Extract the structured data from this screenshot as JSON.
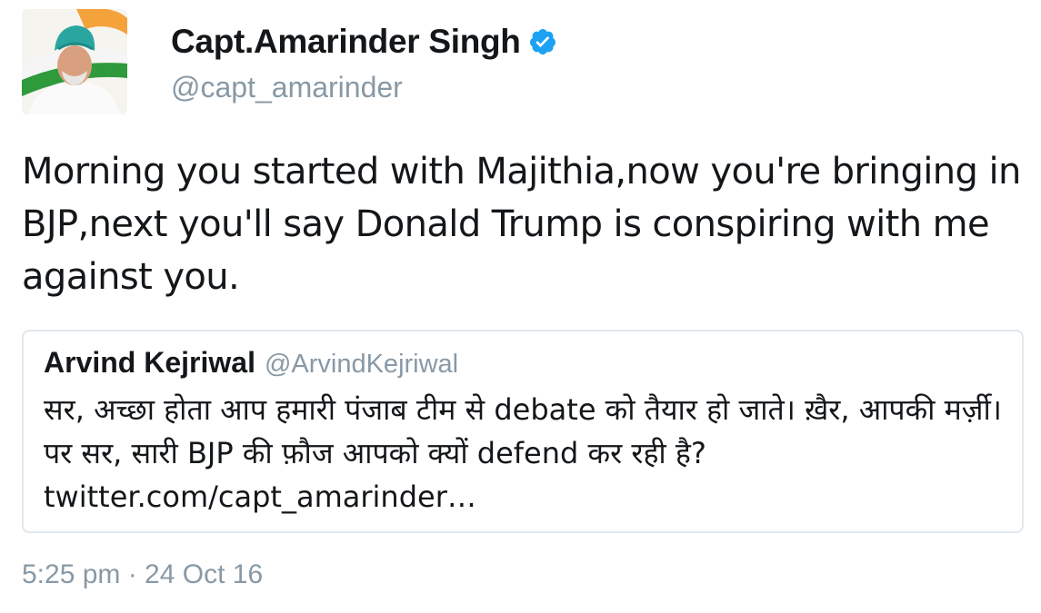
{
  "author": {
    "name": "Capt.Amarinder Singh",
    "handle": "@capt_amarinder",
    "verified": true,
    "avatar_icon": "profile-photo-turban-tricolor"
  },
  "tweet": {
    "text": "Morning you started with Majithia,now you're bringing in BJP,next you'll say Donald Trump is conspiring with me against you."
  },
  "quoted_tweet": {
    "name": "Arvind Kejriwal",
    "handle": "@ArvindKejriwal",
    "text": "सर, अच्छा होता आप हमारी पंजाब टीम से debate को तैयार हो जाते। ख़ैर, आपकी मर्ज़ी। पर सर, सारी BJP की फ़ौज आपको क्यों defend कर रही है? twitter.com/capt_amarinder…"
  },
  "timestamp": "5:25 pm · 24 Oct 16",
  "colors": {
    "verified": "#1da1f2",
    "secondary_text": "#8899a6",
    "card_border": "#e1e8ed"
  }
}
